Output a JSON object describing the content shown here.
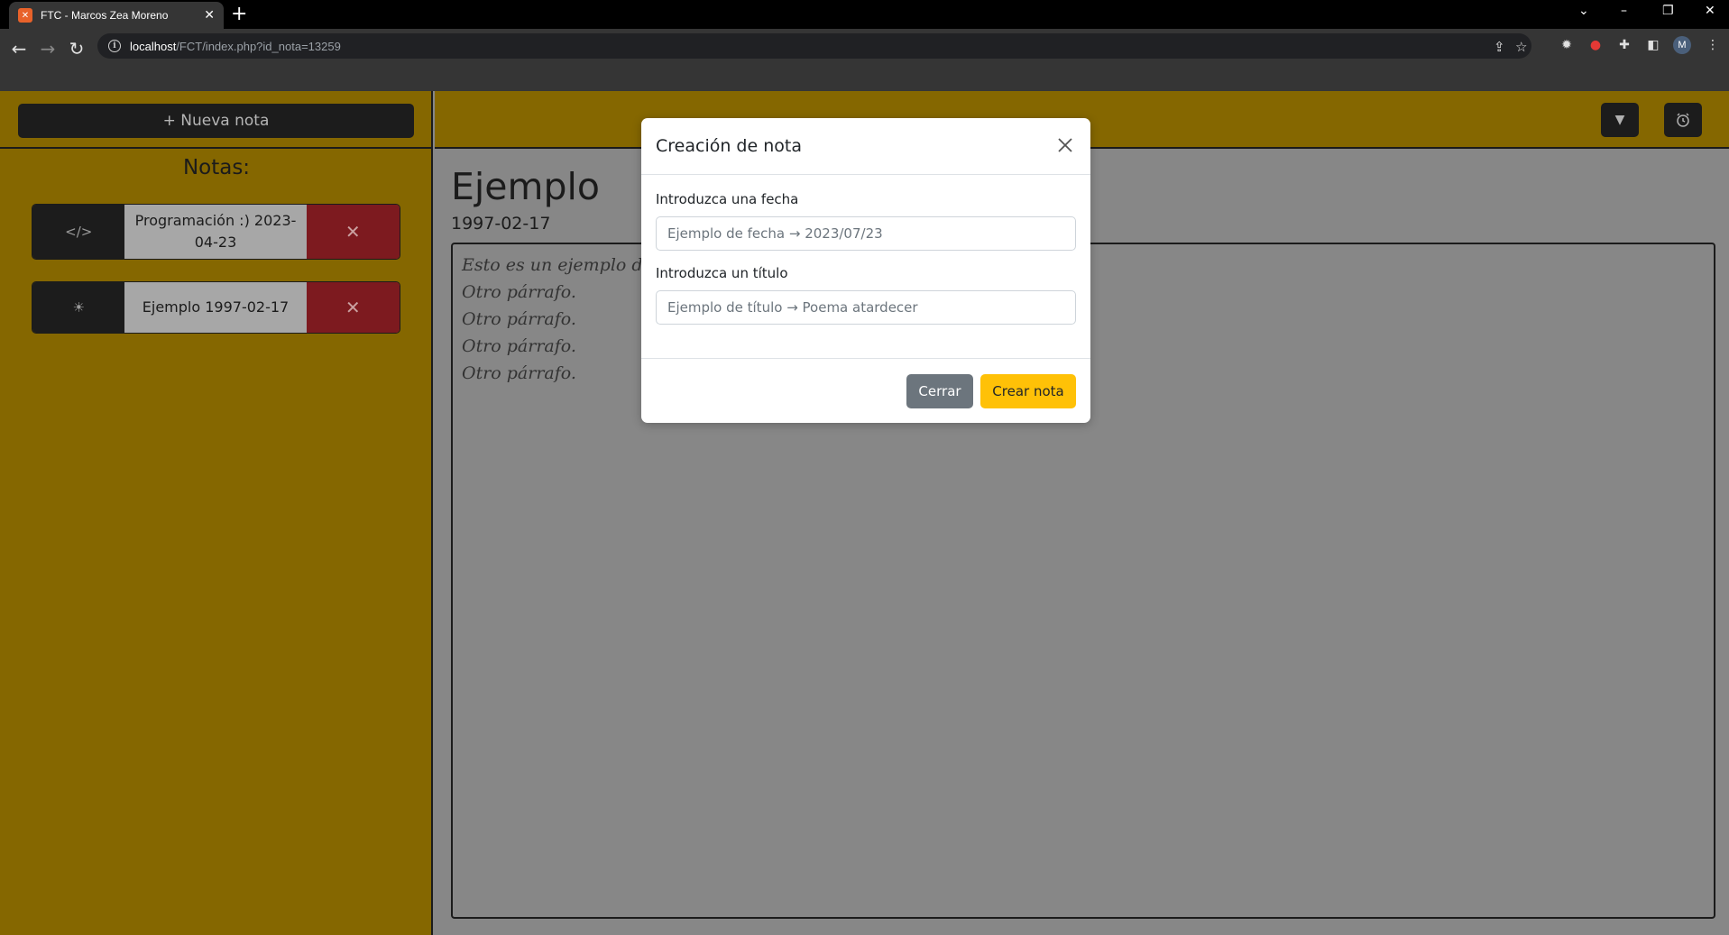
{
  "browser": {
    "tab_title": "FTC - Marcos Zea Moreno",
    "url_host": "localhost",
    "url_path": "/FCT/index.php?id_nota=13259",
    "avatar_letter": "M"
  },
  "sidebar": {
    "new_note_label": "+ Nueva nota",
    "notes_heading": "Notas:",
    "notes": [
      {
        "icon": "code-icon",
        "label": "Programación :) 2023-04-23"
      },
      {
        "icon": "sun-icon",
        "label": "Ejemplo 1997-02-17"
      }
    ]
  },
  "main": {
    "title": "Ejemplo",
    "date": "1997-02-17",
    "content_lines": [
      "Esto es un ejemplo de una",
      "Otro párrafo.",
      "Otro párrafo.",
      "Otro párrafo.",
      "Otro párrafo."
    ]
  },
  "modal": {
    "title": "Creación de nota",
    "date_label": "Introduzca una fecha",
    "date_placeholder": "Ejemplo de fecha → 2023/07/23",
    "title_label": "Introduzca un título",
    "title_placeholder": "Ejemplo de título → Poema atardecer",
    "close_label": "Cerrar",
    "create_label": "Crear nota"
  },
  "colors": {
    "background_accent": "#856700",
    "dark_button": "#1c1c1c",
    "delete_red": "#7d1a1f",
    "create_yellow": "#ffc107",
    "close_gray": "#6c757d"
  }
}
